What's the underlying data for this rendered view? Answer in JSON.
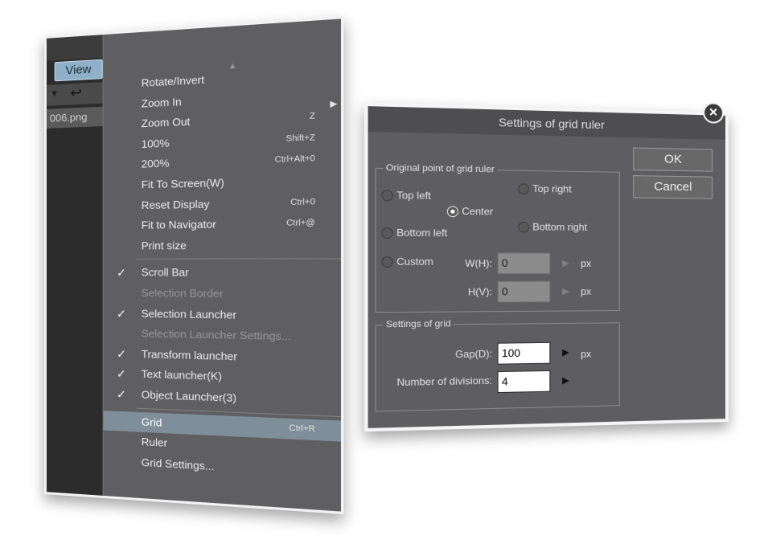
{
  "app": {
    "view_tab": "View",
    "file_tab": "006.png"
  },
  "menu": {
    "items": [
      {
        "label": "Rotate/Invert",
        "shortcut": "",
        "checked": false,
        "disabled": false
      },
      {
        "label": "Zoom In",
        "shortcut": "",
        "checked": false,
        "disabled": false
      },
      {
        "label": "Zoom Out",
        "shortcut": "Z",
        "checked": false,
        "disabled": false
      },
      {
        "label": "100%",
        "shortcut": "Shift+Z",
        "checked": false,
        "disabled": false
      },
      {
        "label": "200%",
        "shortcut": "Ctrl+Alt+0",
        "checked": false,
        "disabled": false
      },
      {
        "label": "Fit To Screen(W)",
        "shortcut": "",
        "checked": false,
        "disabled": false
      },
      {
        "label": "Reset Display",
        "shortcut": "Ctrl+0",
        "checked": false,
        "disabled": false
      },
      {
        "label": "Fit to Navigator",
        "shortcut": "Ctrl+@",
        "checked": false,
        "disabled": false
      },
      {
        "label": "Print size",
        "shortcut": "",
        "checked": false,
        "disabled": false
      },
      {
        "label": "Scroll Bar",
        "shortcut": "",
        "checked": true,
        "disabled": false
      },
      {
        "label": "Selection Border",
        "shortcut": "",
        "checked": false,
        "disabled": true
      },
      {
        "label": "Selection Launcher",
        "shortcut": "",
        "checked": true,
        "disabled": false
      },
      {
        "label": "Selection Launcher Settings...",
        "shortcut": "",
        "checked": false,
        "disabled": true
      },
      {
        "label": "Transform launcher",
        "shortcut": "",
        "checked": true,
        "disabled": false
      },
      {
        "label": "Text launcher(K)",
        "shortcut": "",
        "checked": true,
        "disabled": false
      },
      {
        "label": "Object Launcher(3)",
        "shortcut": "",
        "checked": true,
        "disabled": false
      },
      {
        "label": "Grid",
        "shortcut": "Ctrl+R",
        "checked": false,
        "disabled": false,
        "highlighted": true
      },
      {
        "label": "Ruler",
        "shortcut": "",
        "checked": false,
        "disabled": false
      },
      {
        "label": "Grid Settings...",
        "shortcut": "",
        "checked": false,
        "disabled": false
      }
    ],
    "check_glyph": "✓"
  },
  "dialog": {
    "title": "Settings of grid ruler",
    "ok_label": "OK",
    "cancel_label": "Cancel",
    "origin_group": {
      "title": "Original point of grid ruler",
      "options": {
        "top_left": "Top left",
        "top_right": "Top right",
        "center": "Center",
        "bottom_left": "Bottom left",
        "bottom_right": "Bottom right",
        "custom": "Custom"
      },
      "selected": "Center",
      "w_label": "W(H):",
      "w_value": "0",
      "h_label": "H(V):",
      "h_value": "0",
      "unit": "px"
    },
    "grid_group": {
      "title": "Settings of grid",
      "gap_label": "Gap(D):",
      "gap_value": "100",
      "gap_unit": "px",
      "divisions_label": "Number of divisions:",
      "divisions_value": "4"
    }
  }
}
